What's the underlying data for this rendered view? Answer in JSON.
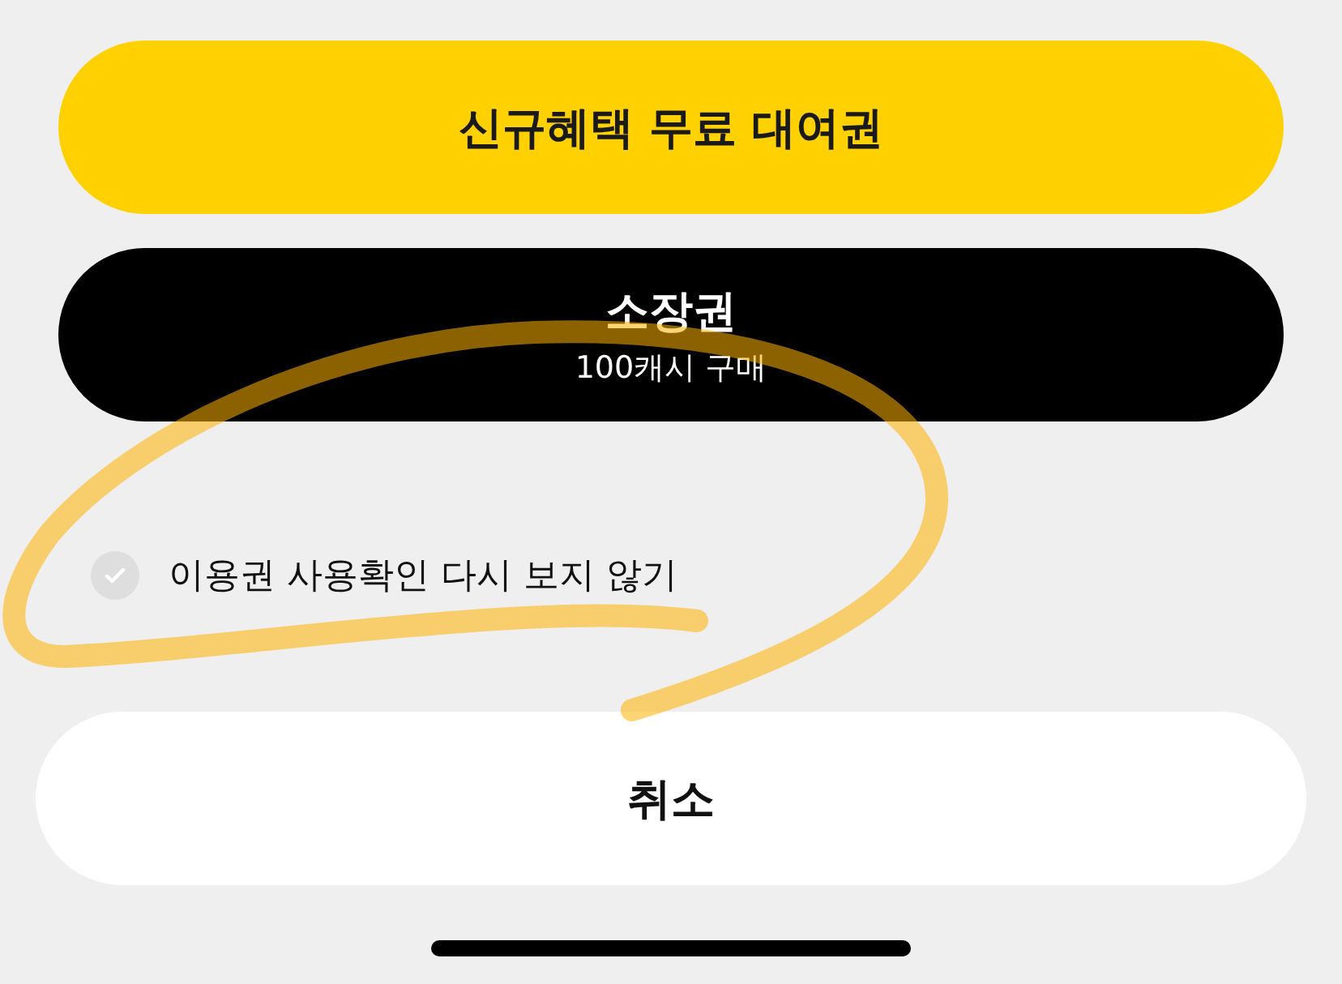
{
  "buttons": [
    {
      "kind": "primary",
      "title": "신규혜택 무료 대여권"
    },
    {
      "kind": "dark",
      "title": "소장권",
      "subtitle": "100캐시 구매"
    }
  ],
  "option": {
    "label": "이용권 사용확인 다시 보지 않기",
    "checked": false
  },
  "cancel": {
    "label": "취소"
  }
}
